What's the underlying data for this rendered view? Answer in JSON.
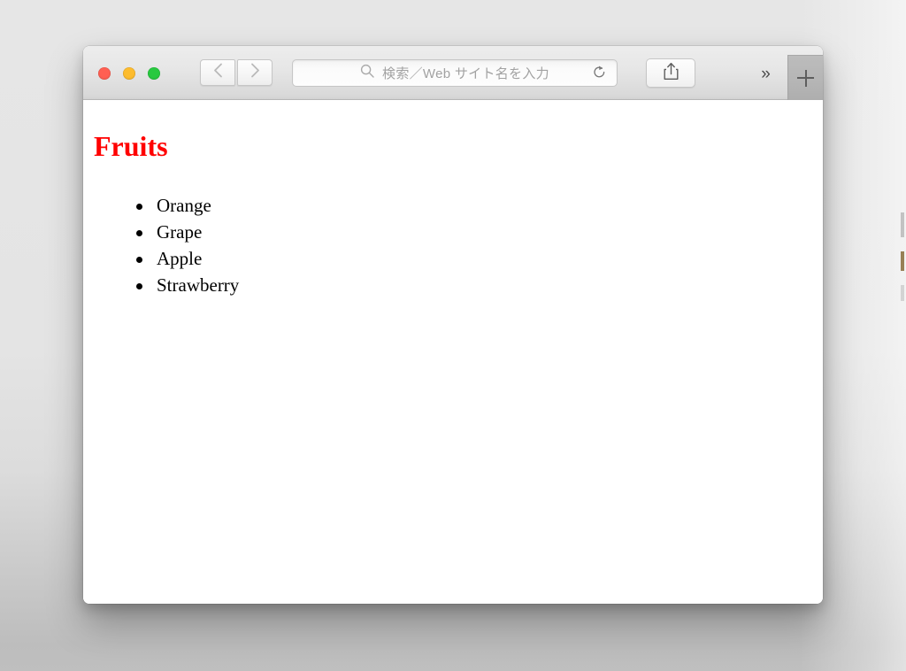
{
  "window": {
    "traffic_lights": [
      {
        "name": "close",
        "color": "#ff5f52"
      },
      {
        "name": "minimize",
        "color": "#fdbc2e"
      },
      {
        "name": "zoom",
        "color": "#28c93f"
      }
    ]
  },
  "toolbar": {
    "back_icon": "chevron-left-icon",
    "forward_icon": "chevron-right-icon",
    "search": {
      "value": "",
      "placeholder": "検索／Web サイト名を入力",
      "search_icon": "search-icon",
      "reload_icon": "reload-icon"
    },
    "share_icon": "share-icon",
    "overflow_label": "»",
    "new_tab_label": "+"
  },
  "page": {
    "title": "Fruits",
    "title_color": "#ff0000",
    "list": [
      {
        "label": "Orange"
      },
      {
        "label": "Grape"
      },
      {
        "label": "Apple"
      },
      {
        "label": "Strawberry"
      }
    ]
  }
}
